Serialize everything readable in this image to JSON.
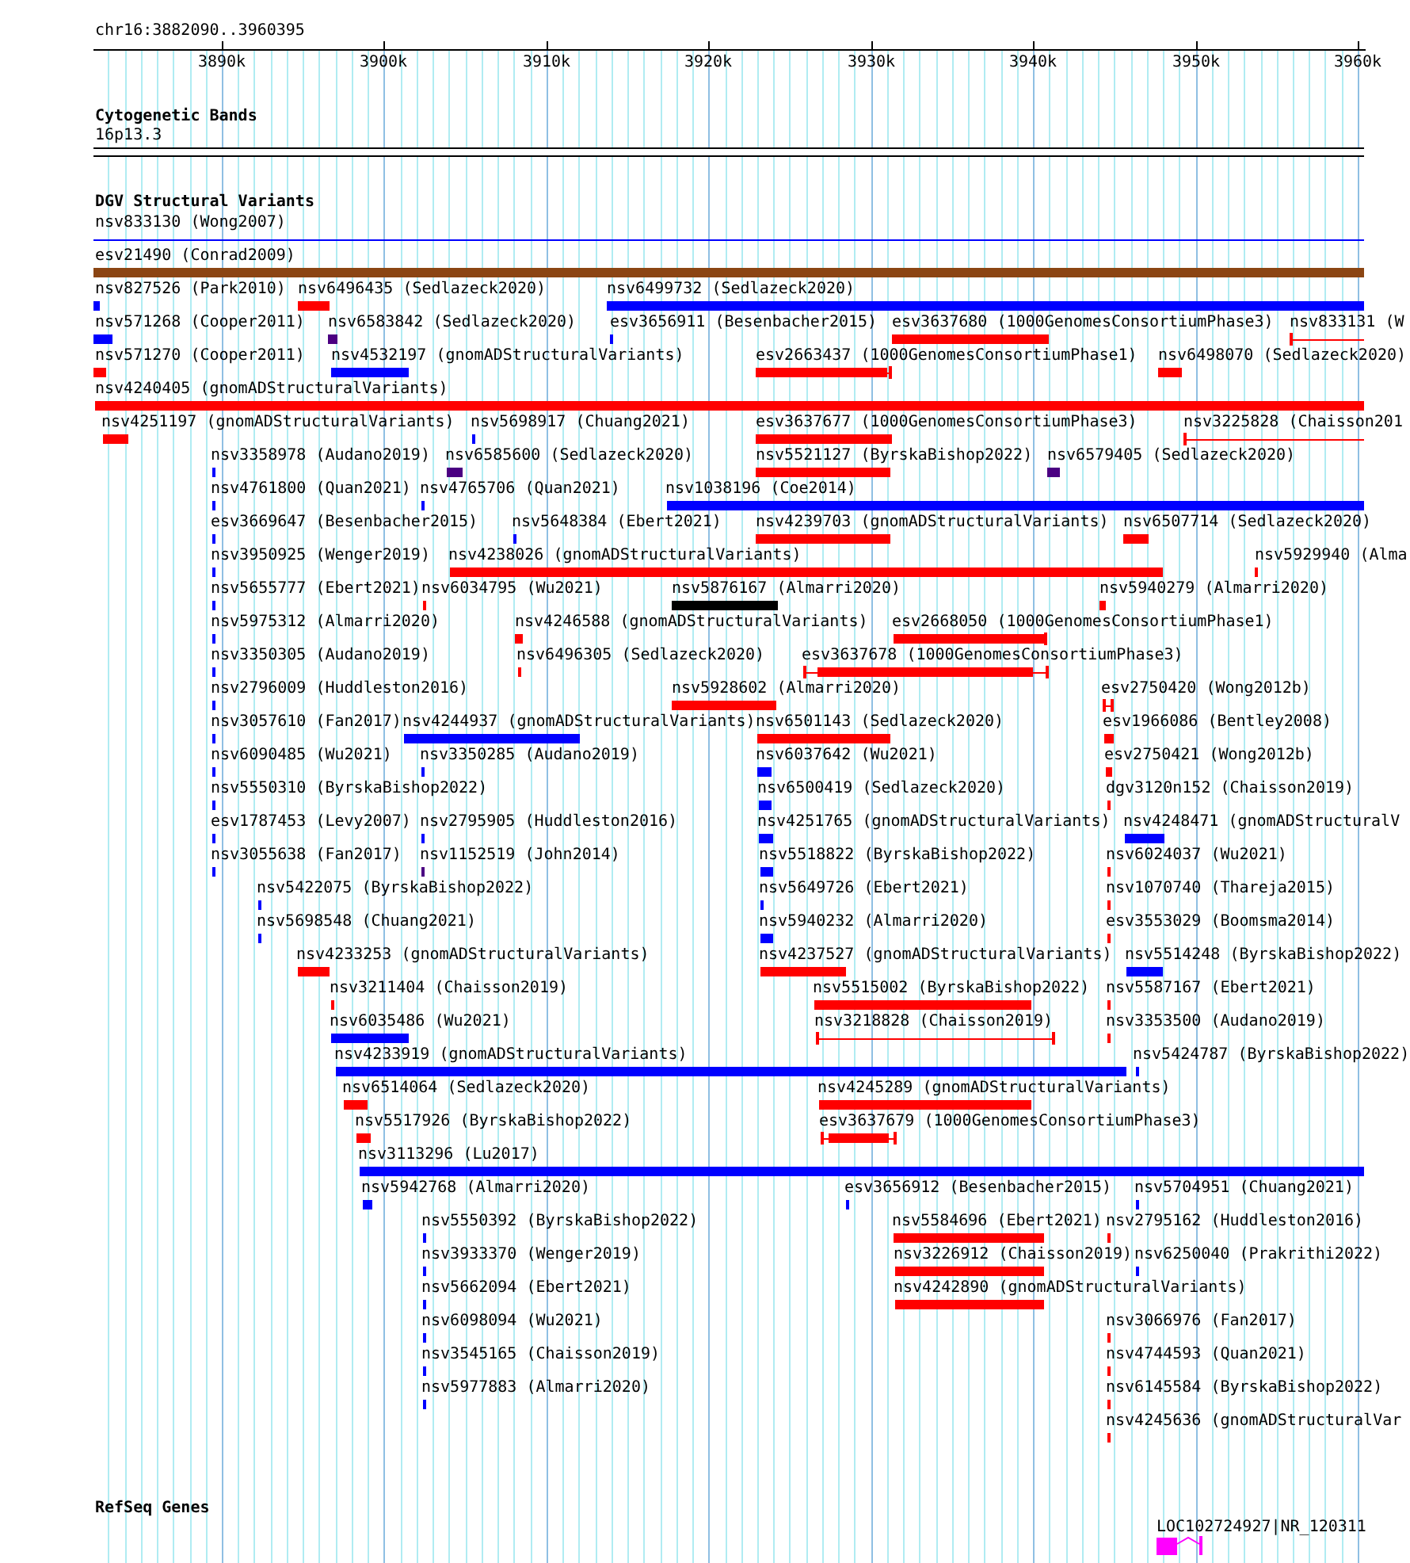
{
  "ruler": {
    "label": "chr16:3882090..3960395",
    "ticks": [
      "3890k",
      "3900k",
      "3910k",
      "3920k",
      "3930k",
      "3940k",
      "3950k",
      "3960k"
    ]
  },
  "tracks": [
    {
      "title": "Cytogenetic Bands",
      "kind": "bands",
      "features": [
        {
          "label": "16p13.3"
        }
      ]
    },
    {
      "title": "DGV Structural Variants",
      "kind": "variants",
      "features": [
        {
          "label": "nsv833130 (Wong2007)",
          "color": "#0000ff",
          "kind": "line"
        },
        {
          "label": "esv21490 (Conrad2009)",
          "color": "#8b4513",
          "kind": "bar"
        },
        {
          "label": "nsv827526 (Park2010)",
          "color": "#0000ff",
          "kind": "bar"
        },
        {
          "label": "nsv6496435 (Sedlazeck2020)",
          "color": "#ff0000",
          "kind": "bar"
        },
        {
          "label": "nsv6499732 (Sedlazeck2020)",
          "color": "#0000ff",
          "kind": "bar"
        },
        {
          "label": "nsv571268 (Cooper2011)",
          "color": "#0000ff",
          "kind": "bar"
        },
        {
          "label": "nsv6583842 (Sedlazeck2020)",
          "color": "#4b0082",
          "kind": "bar"
        },
        {
          "label": "esv3656911 (Besenbacher2015)",
          "color": "#0000ff",
          "kind": "bar"
        },
        {
          "label": "esv3637680 (1000GenomesConsortiumPhase3)",
          "color": "#ff0000",
          "kind": "bar"
        },
        {
          "label": "nsv833131 (W",
          "color": "#ff0000",
          "kind": "line"
        },
        {
          "label": "nsv571270 (Cooper2011)",
          "color": "#ff0000",
          "kind": "bar"
        },
        {
          "label": "nsv4532197 (gnomADStructuralVariants)",
          "color": "#0000ff",
          "kind": "bar"
        },
        {
          "label": "esv2663437 (1000GenomesConsortiumPhase1)",
          "color": "#ff0000",
          "kind": "bar"
        },
        {
          "label": "nsv6498070 (Sedlazeck2020)",
          "color": "#ff0000",
          "kind": "bar"
        },
        {
          "label": "nsv4240405 (gnomADStructuralVariants)",
          "color": "#ff0000",
          "kind": "bar"
        },
        {
          "label": "nsv4251197 (gnomADStructuralVariants)",
          "color": "#ff0000",
          "kind": "bar"
        },
        {
          "label": "nsv5698917 (Chuang2021)",
          "color": "#0000ff",
          "kind": "bar"
        },
        {
          "label": "esv3637677 (1000GenomesConsortiumPhase3)",
          "color": "#ff0000",
          "kind": "bar"
        },
        {
          "label": "nsv3225828 (Chaisson201",
          "color": "#ff0000",
          "kind": "line"
        },
        {
          "label": "nsv3358978 (Audano2019)",
          "color": "#0000ff",
          "kind": "bar"
        },
        {
          "label": "nsv6585600 (Sedlazeck2020)",
          "color": "#4b0082",
          "kind": "bar"
        },
        {
          "label": "nsv5521127 (ByrskaBishop2022)",
          "color": "#ff0000",
          "kind": "bar"
        },
        {
          "label": "nsv6579405 (Sedlazeck2020)",
          "color": "#4b0082",
          "kind": "bar"
        },
        {
          "label": "nsv4761800 (Quan2021)",
          "color": "#0000ff",
          "kind": "bar"
        },
        {
          "label": "nsv4765706 (Quan2021)",
          "color": "#0000ff",
          "kind": "bar"
        },
        {
          "label": "nsv1038196 (Coe2014)",
          "color": "#0000ff",
          "kind": "bar"
        },
        {
          "label": "esv3669647 (Besenbacher2015)",
          "color": "#0000ff",
          "kind": "bar"
        },
        {
          "label": "nsv5648384 (Ebert2021)",
          "color": "#0000ff",
          "kind": "bar"
        },
        {
          "label": "nsv4239703 (gnomADStructuralVariants)",
          "color": "#ff0000",
          "kind": "bar"
        },
        {
          "label": "nsv6507714 (Sedlazeck2020)",
          "color": "#ff0000",
          "kind": "bar"
        },
        {
          "label": "nsv3950925 (Wenger2019)",
          "color": "#0000ff",
          "kind": "bar"
        },
        {
          "label": "nsv4238026 (gnomADStructuralVariants)",
          "color": "#ff0000",
          "kind": "bar"
        },
        {
          "label": "nsv5929940 (Alma",
          "color": "#ff0000",
          "kind": "bar"
        },
        {
          "label": "nsv5655777 (Ebert2021)",
          "color": "#0000ff",
          "kind": "bar"
        },
        {
          "label": "nsv6034795 (Wu2021)",
          "color": "#ff0000",
          "kind": "bar"
        },
        {
          "label": "nsv5876167 (Almarri2020)",
          "color": "#000000",
          "kind": "bar"
        },
        {
          "label": "nsv5940279 (Almarri2020)",
          "color": "#ff0000",
          "kind": "bar"
        },
        {
          "label": "nsv5975312 (Almarri2020)",
          "color": "#0000ff",
          "kind": "bar"
        },
        {
          "label": "nsv4246588 (gnomADStructuralVariants)",
          "color": "#ff0000",
          "kind": "bar"
        },
        {
          "label": "esv2668050 (1000GenomesConsortiumPhase1)",
          "color": "#ff0000",
          "kind": "bar"
        },
        {
          "label": "nsv3350305 (Audano2019)",
          "color": "#0000ff",
          "kind": "bar"
        },
        {
          "label": "nsv6496305 (Sedlazeck2020)",
          "color": "#ff0000",
          "kind": "bar"
        },
        {
          "label": "esv3637678 (1000GenomesConsortiumPhase3)",
          "color": "#ff0000",
          "kind": "bar"
        },
        {
          "label": "nsv2796009 (Huddleston2016)",
          "color": "#0000ff",
          "kind": "bar"
        },
        {
          "label": "nsv5928602 (Almarri2020)",
          "color": "#ff0000",
          "kind": "bar"
        },
        {
          "label": "esv2750420 (Wong2012b)",
          "color": "#ff0000",
          "kind": "line"
        },
        {
          "label": "nsv3057610 (Fan2017)",
          "color": "#0000ff",
          "kind": "bar"
        },
        {
          "label": "nsv4244937 (gnomADStructuralVariants)",
          "color": "#0000ff",
          "kind": "bar"
        },
        {
          "label": "nsv6501143 (Sedlazeck2020)",
          "color": "#ff0000",
          "kind": "bar"
        },
        {
          "label": "esv1966086 (Bentley2008)",
          "color": "#ff0000",
          "kind": "bar"
        },
        {
          "label": "nsv6090485 (Wu2021)",
          "color": "#0000ff",
          "kind": "bar"
        },
        {
          "label": "nsv3350285 (Audano2019)",
          "color": "#0000ff",
          "kind": "bar"
        },
        {
          "label": "nsv6037642 (Wu2021)",
          "color": "#0000ff",
          "kind": "bar"
        },
        {
          "label": "esv2750421 (Wong2012b)",
          "color": "#ff0000",
          "kind": "bar"
        },
        {
          "label": "nsv5550310 (ByrskaBishop2022)",
          "color": "#0000ff",
          "kind": "bar"
        },
        {
          "label": "nsv6500419 (Sedlazeck2020)",
          "color": "#0000ff",
          "kind": "bar"
        },
        {
          "label": "dgv3120n152 (Chaisson2019)",
          "color": "#ff0000",
          "kind": "bar"
        },
        {
          "label": "esv1787453 (Levy2007)",
          "color": "#0000ff",
          "kind": "bar"
        },
        {
          "label": "nsv2795905 (Huddleston2016)",
          "color": "#0000ff",
          "kind": "bar"
        },
        {
          "label": "nsv4251765 (gnomADStructuralVariants)",
          "color": "#0000ff",
          "kind": "bar"
        },
        {
          "label": "nsv4248471 (gnomADStructuralV",
          "color": "#0000ff",
          "kind": "bar"
        },
        {
          "label": "nsv3055638 (Fan2017)",
          "color": "#0000ff",
          "kind": "bar"
        },
        {
          "label": "nsv1152519 (John2014)",
          "color": "#4b0082",
          "kind": "bar"
        },
        {
          "label": "nsv5518822 (ByrskaBishop2022)",
          "color": "#0000ff",
          "kind": "bar"
        },
        {
          "label": "nsv6024037 (Wu2021)",
          "color": "#ff0000",
          "kind": "bar"
        },
        {
          "label": "nsv5422075 (ByrskaBishop2022)",
          "color": "#0000ff",
          "kind": "bar"
        },
        {
          "label": "nsv5649726 (Ebert2021)",
          "color": "#0000ff",
          "kind": "bar"
        },
        {
          "label": "nsv1070740 (Thareja2015)",
          "color": "#ff0000",
          "kind": "bar"
        },
        {
          "label": "nsv5698548 (Chuang2021)",
          "color": "#0000ff",
          "kind": "bar"
        },
        {
          "label": "nsv5940232 (Almarri2020)",
          "color": "#0000ff",
          "kind": "bar"
        },
        {
          "label": "esv3553029 (Boomsma2014)",
          "color": "#ff0000",
          "kind": "bar"
        },
        {
          "label": "nsv4233253 (gnomADStructuralVariants)",
          "color": "#ff0000",
          "kind": "bar"
        },
        {
          "label": "nsv4237527 (gnomADStructuralVariants)",
          "color": "#ff0000",
          "kind": "bar"
        },
        {
          "label": "nsv5514248 (ByrskaBishop2022)",
          "color": "#0000ff",
          "kind": "bar"
        },
        {
          "label": "nsv3211404 (Chaisson2019)",
          "color": "#ff0000",
          "kind": "bar"
        },
        {
          "label": "nsv5515002 (ByrskaBishop2022)",
          "color": "#ff0000",
          "kind": "bar"
        },
        {
          "label": "nsv5587167 (Ebert2021)",
          "color": "#ff0000",
          "kind": "bar"
        },
        {
          "label": "nsv6035486 (Wu2021)",
          "color": "#0000ff",
          "kind": "bar"
        },
        {
          "label": "nsv3218828 (Chaisson2019)",
          "color": "#ff0000",
          "kind": "line"
        },
        {
          "label": "nsv3353500 (Audano2019)",
          "color": "#ff0000",
          "kind": "bar"
        },
        {
          "label": "nsv4233919 (gnomADStructuralVariants)",
          "color": "#0000ff",
          "kind": "bar"
        },
        {
          "label": "nsv5424787 (ByrskaBishop2022)",
          "color": "#0000ff",
          "kind": "bar"
        },
        {
          "label": "nsv6514064 (Sedlazeck2020)",
          "color": "#ff0000",
          "kind": "bar"
        },
        {
          "label": "nsv4245289 (gnomADStructuralVariants)",
          "color": "#ff0000",
          "kind": "bar"
        },
        {
          "label": "nsv5517926 (ByrskaBishop2022)",
          "color": "#ff0000",
          "kind": "bar"
        },
        {
          "label": "esv3637679 (1000GenomesConsortiumPhase3)",
          "color": "#ff0000",
          "kind": "bar"
        },
        {
          "label": "nsv3113296 (Lu2017)",
          "color": "#0000ff",
          "kind": "bar"
        },
        {
          "label": "nsv5942768 (Almarri2020)",
          "color": "#0000ff",
          "kind": "bar"
        },
        {
          "label": "esv3656912 (Besenbacher2015)",
          "color": "#0000ff",
          "kind": "bar"
        },
        {
          "label": "nsv5704951 (Chuang2021)",
          "color": "#0000ff",
          "kind": "bar"
        },
        {
          "label": "nsv5550392 (ByrskaBishop2022)",
          "color": "#0000ff",
          "kind": "bar"
        },
        {
          "label": "nsv5584696 (Ebert2021)",
          "color": "#ff0000",
          "kind": "bar"
        },
        {
          "label": "nsv2795162 (Huddleston2016)",
          "color": "#ff0000",
          "kind": "bar"
        },
        {
          "label": "nsv3933370 (Wenger2019)",
          "color": "#0000ff",
          "kind": "bar"
        },
        {
          "label": "nsv3226912 (Chaisson2019)",
          "color": "#ff0000",
          "kind": "bar"
        },
        {
          "label": "nsv6250040 (Prakrithi2022)",
          "color": "#0000ff",
          "kind": "bar"
        },
        {
          "label": "nsv5662094 (Ebert2021)",
          "color": "#0000ff",
          "kind": "bar"
        },
        {
          "label": "nsv4242890 (gnomADStructuralVariants)",
          "color": "#ff0000",
          "kind": "bar"
        },
        {
          "label": "nsv6098094 (Wu2021)",
          "color": "#0000ff",
          "kind": "bar"
        },
        {
          "label": "nsv3066976 (Fan2017)",
          "color": "#ff0000",
          "kind": "bar"
        },
        {
          "label": "nsv3545165 (Chaisson2019)",
          "color": "#0000ff",
          "kind": "bar"
        },
        {
          "label": "nsv4744593 (Quan2021)",
          "color": "#ff0000",
          "kind": "bar"
        },
        {
          "label": "nsv5977883 (Almarri2020)",
          "color": "#0000ff",
          "kind": "bar"
        },
        {
          "label": "nsv6145584 (ByrskaBishop2022)",
          "color": "#ff0000",
          "kind": "bar"
        },
        {
          "label": "nsv4245636 (gnomADStructuralVar",
          "color": "#ff0000",
          "kind": "bar"
        }
      ]
    },
    {
      "title": "RefSeq Genes",
      "kind": "genes",
      "features": [
        {
          "label": "LOC102724927|NR_120311",
          "color": "#ff00ff"
        }
      ]
    }
  ]
}
